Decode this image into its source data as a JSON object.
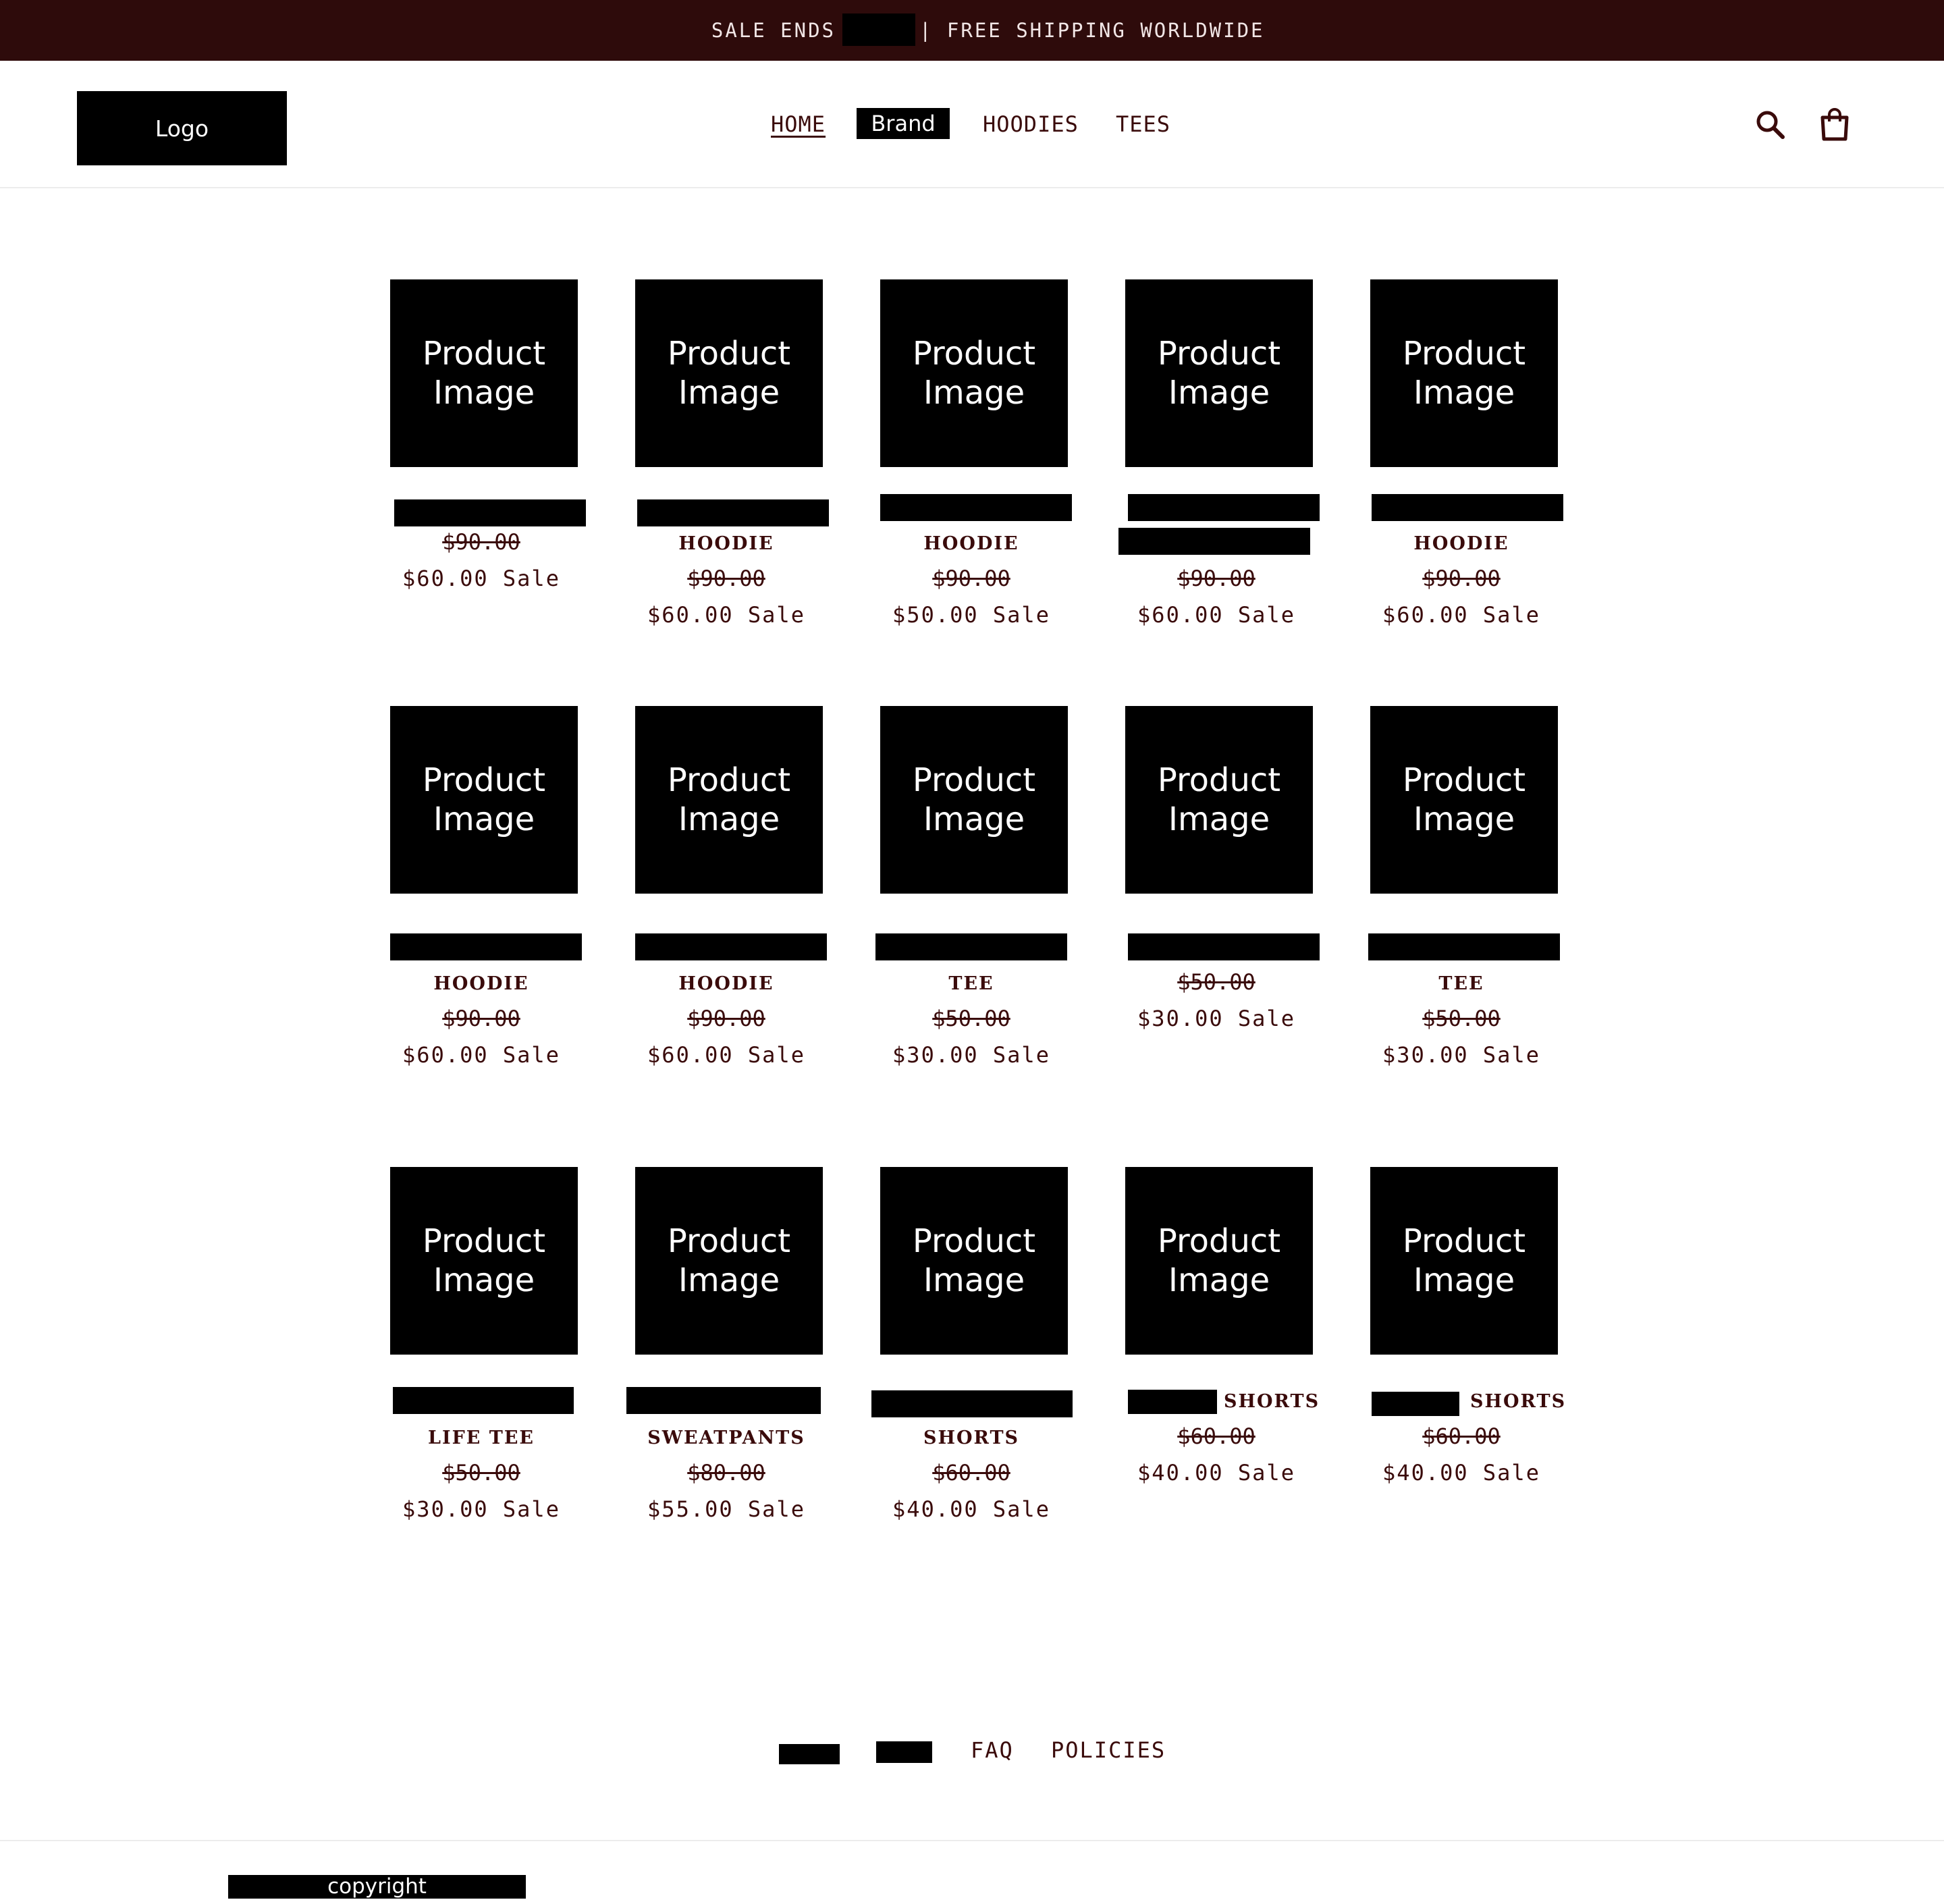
{
  "announcement": {
    "left": "SALE ENDS",
    "right": "| FREE SHIPPING WORLDWIDE"
  },
  "header": {
    "logo": "Logo",
    "nav": {
      "home": "HOME",
      "brand": "Brand",
      "hoodies": "HOODIES",
      "tees": "TEES"
    },
    "icons": {
      "search": "search-icon",
      "cart": "shopping-bag-icon"
    }
  },
  "image_placeholder": {
    "line1": "Product",
    "line2": "Image"
  },
  "products": [
    {
      "name": "",
      "original_price": "$90.00",
      "sale_price": "$60.00 Sale"
    },
    {
      "name": "HOODIE",
      "original_price": "$90.00",
      "sale_price": "$60.00 Sale"
    },
    {
      "name": "HOODIE",
      "original_price": "$90.00",
      "sale_price": "$50.00 Sale"
    },
    {
      "name": "",
      "original_price": "$90.00",
      "sale_price": "$60.00 Sale"
    },
    {
      "name": "HOODIE",
      "original_price": "$90.00",
      "sale_price": "$60.00 Sale"
    },
    {
      "name": "HOODIE",
      "original_price": "$90.00",
      "sale_price": "$60.00 Sale"
    },
    {
      "name": "HOODIE",
      "original_price": "$90.00",
      "sale_price": "$60.00 Sale"
    },
    {
      "name": "TEE",
      "original_price": "$50.00",
      "sale_price": "$30.00 Sale"
    },
    {
      "name": "",
      "original_price": "$50.00",
      "sale_price": "$30.00 Sale"
    },
    {
      "name": "TEE",
      "original_price": "$50.00",
      "sale_price": "$30.00 Sale"
    },
    {
      "name": "LIFE TEE",
      "original_price": "$50.00",
      "sale_price": "$30.00 Sale"
    },
    {
      "name": "SWEATPANTS",
      "original_price": "$80.00",
      "sale_price": "$55.00 Sale"
    },
    {
      "name": "SHORTS",
      "original_price": "$60.00",
      "sale_price": "$40.00 Sale"
    },
    {
      "name": "SHORTS",
      "original_price": "$60.00",
      "sale_price": "$40.00 Sale"
    },
    {
      "name": "SHORTS",
      "original_price": "$60.00",
      "sale_price": "$40.00 Sale"
    }
  ],
  "footer": {
    "links": {
      "faq": "FAQ",
      "policies": "POLICIES"
    },
    "copyright": "copyright"
  },
  "colors": {
    "accent": "#2e0b0b",
    "text": "#3a0b0b",
    "redaction": "#000000"
  }
}
